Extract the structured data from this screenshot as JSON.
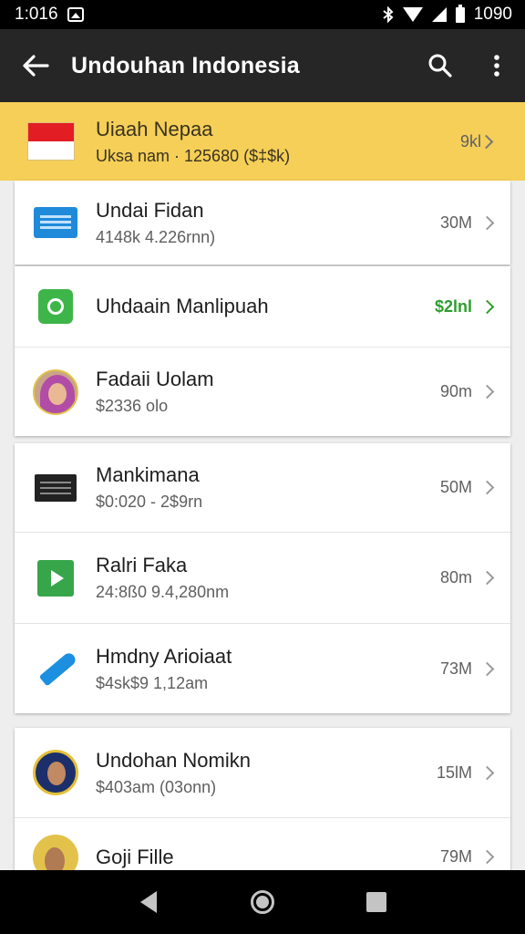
{
  "status_bar": {
    "time": "1:016",
    "battery": "1090",
    "icons": [
      "image-icon",
      "bluetooth-icon",
      "wifi-icon",
      "signal-icon",
      "battery-icon"
    ]
  },
  "app_bar": {
    "title": "Undouhan Indonesia",
    "icons": [
      "back-arrow-icon",
      "search-icon",
      "more-vert-icon"
    ]
  },
  "colors": {
    "status_bar": "#000000",
    "app_bar": "#262626",
    "highlight": "#f5cf57",
    "accent_green": "#2e9e2e",
    "background": "#eeeeee"
  },
  "highlight_item": {
    "icon": "indonesia-flag-icon",
    "title": "Uiaah Nepaa",
    "subtitle": "Uksa nam · 125680 ($‡$k)",
    "size": "9kl"
  },
  "cards": [
    {
      "items": [
        {
          "icon": "document-icon",
          "title": "Undai Fidan",
          "subtitle": "4148k 4.226rnn)",
          "size": "30M"
        }
      ]
    },
    {
      "items": [
        {
          "icon": "green-app-icon",
          "title": "Uhdaain Manlipuah",
          "subtitle": "",
          "size": "$2lnl",
          "highlight": true
        },
        {
          "icon": "avatar-icon",
          "title": "Fadaii Uolam",
          "subtitle": "$2336 olo",
          "size": "90m"
        }
      ]
    },
    {
      "items": [
        {
          "icon": "keyboard-icon",
          "title": "Mankimana",
          "subtitle": "$0:020 - 2$9rn",
          "size": "50M"
        },
        {
          "icon": "play-icon",
          "title": "Ralri Faka",
          "subtitle": "24:8ß0 9.4,280nm",
          "size": "80m"
        },
        {
          "icon": "pen-icon",
          "title": "Hmdny Arioiaat",
          "subtitle": "$4sk$9 1,12am",
          "size": "73M"
        }
      ]
    },
    {
      "items": [
        {
          "icon": "avatar-icon",
          "title": "Undohan Nomikn",
          "subtitle": "$403am (03onn)",
          "size": "15lM"
        },
        {
          "icon": "avatar-icon",
          "title": "Goji Fille",
          "subtitle": "",
          "size": "79M"
        }
      ]
    }
  ],
  "nav_bar": {
    "icons": [
      "nav-back-icon",
      "nav-home-icon",
      "nav-recents-icon"
    ]
  }
}
